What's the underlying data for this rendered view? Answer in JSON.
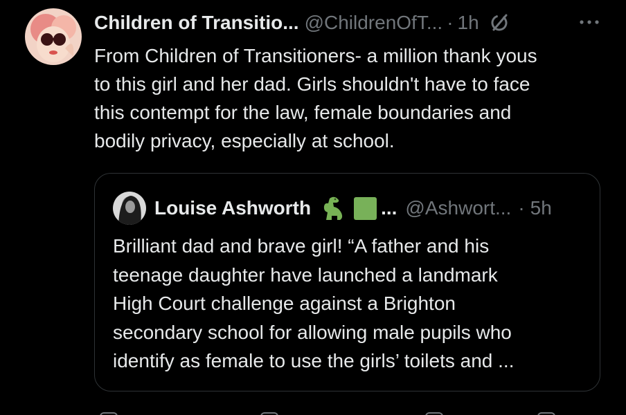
{
  "post": {
    "display_name": "Children of Transitio...",
    "handle": "@ChildrenOfT...",
    "separator": "·",
    "time": "1h",
    "more_icon": "more-horizontal-icon",
    "grok_icon": "grok-icon",
    "text_lines": [
      "From Children of Transitioners- a  million thank yous",
      "to this girl and her dad. Girls  shouldn't have to face",
      "this contempt for the law, female  boundaries and",
      "bodily privacy, especially  at school."
    ]
  },
  "quote": {
    "display_name": "Louise Ashworth",
    "emoji_1": "dinosaur-icon",
    "emoji_2": "green-square-icon",
    "name_ellipsis": "...",
    "handle": "@Ashwort...",
    "separator": "·",
    "time": "5h",
    "text_lines": [
      "Brilliant dad and brave girl! “A father and his",
      "teenage daughter have launched a landmark",
      "High Court challenge against a Brighton",
      "secondary school for allowing male pupils who",
      "identify as female to use the girls’ toilets and ..."
    ]
  },
  "colors": {
    "background": "#000000",
    "primary_text": "#e7e9ea",
    "secondary_text": "#71767b",
    "border": "#2f3336",
    "green_square": "#78b159"
  }
}
